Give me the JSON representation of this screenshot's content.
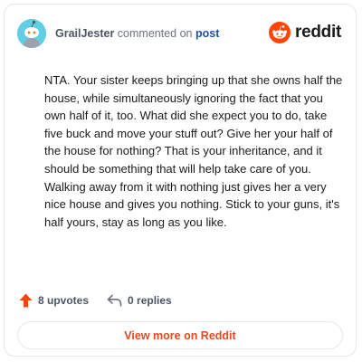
{
  "header": {
    "username": "GrailJester",
    "action_text": " commented on ",
    "post_link": "post",
    "brand_name": "reddit"
  },
  "comment": {
    "body": "NTA. Your sister keeps bringing up that she owns half the house, while simultaneously ignoring the fact that you own half of it, too. What did she expect you to do, take five buck and move your stuff out? Give her your half of the house for nothing? That is your inheritance, and it should be something that will help take care of you. Walking away from it with nothing just gives her a very nice house and gives you nothing. Stick to your guns, it's half yours, stay as long as you like."
  },
  "actions": {
    "upvotes": "8 upvotes",
    "replies": "0 replies"
  },
  "footer": {
    "view_label": "View more on Reddit"
  },
  "colors": {
    "accent": "#ff4500",
    "link": "#1f4fa8",
    "avatar_bg": "#5fd0e4"
  },
  "icons": {
    "avatar": "snoo-avatar",
    "brand": "reddit-logo-icon",
    "upvote": "arrow-up-icon",
    "reply": "reply-arrow-icon"
  }
}
